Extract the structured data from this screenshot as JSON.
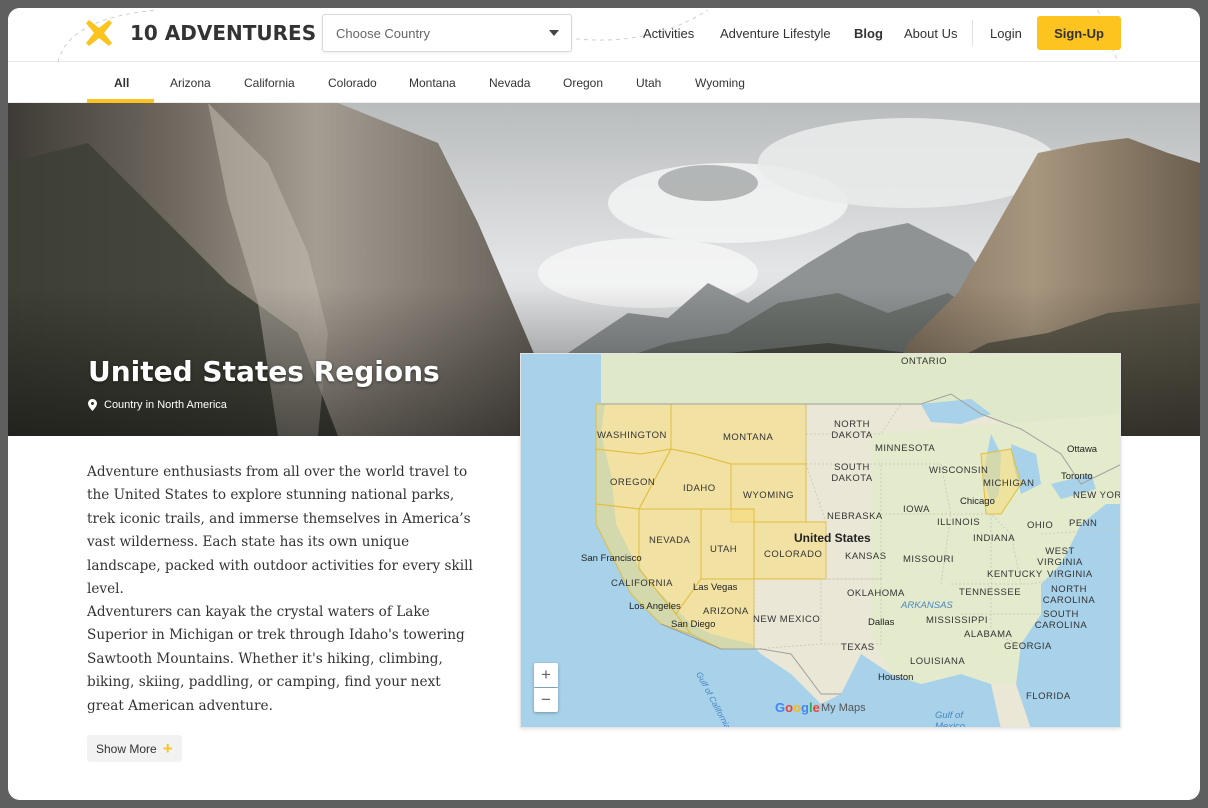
{
  "brand": {
    "name": "10 ADVENTURES",
    "logo_icon": "x-mark-icon",
    "accent": "#fdc31f"
  },
  "header": {
    "country_select": {
      "placeholder": "Choose Country"
    },
    "nav": [
      {
        "label": "Activities"
      },
      {
        "label": "Adventure Lifestyle"
      },
      {
        "label": "Blog"
      },
      {
        "label": "About Us"
      }
    ],
    "login": "Login",
    "signup": "Sign-Up"
  },
  "tabs": [
    "All",
    "Arizona",
    "California",
    "Colorado",
    "Montana",
    "Nevada",
    "Oregon",
    "Utah",
    "Wyoming"
  ],
  "active_tab": "All",
  "hero": {
    "title": "United States Regions",
    "subtitle": "Country in North America"
  },
  "description": {
    "paragraph1": "Adventure enthusiasts from all over the world travel to the United States to explore stunning national parks, trek iconic trails, and immerse themselves in America’s vast wilderness. Each state has its own unique landscape, packed with outdoor activities for every skill level.",
    "paragraph2": "Adventurers can kayak the crystal waters of Lake Superior in Michigan or trek through Idaho's towering Sawtooth Mountains. Whether it's hiking, climbing, biking, skiing, paddling, or camping, find your next great American adventure.",
    "show_more": "Show More"
  },
  "map": {
    "country_label": "United States",
    "states": [
      "WASHINGTON",
      "MONTANA",
      "NORTH DAKOTA",
      "MINNESOTA",
      "OREGON",
      "IDAHO",
      "WYOMING",
      "SOUTH DAKOTA",
      "WISCONSIN",
      "MICHIGAN",
      "NEBRASKA",
      "IOWA",
      "NEVADA",
      "UTAH",
      "COLORADO",
      "KANSAS",
      "MISSOURI",
      "ILLINOIS",
      "INDIANA",
      "OHIO",
      "PENN",
      "CALIFORNIA",
      "ARIZONA",
      "NEW MEXICO",
      "OKLAHOMA",
      "ARKANSAS",
      "TENNESSEE",
      "KENTUCKY",
      "WEST VIRGINIA",
      "VIRGINIA",
      "NORTH CAROLINA",
      "SOUTH CAROLINA",
      "MISSISSIPPI",
      "ALABAMA",
      "GEORGIA",
      "TEXAS",
      "LOUISIANA",
      "FLORIDA",
      "NEW YOR",
      "ONTARIO"
    ],
    "cities": [
      "Ottawa",
      "Toronto",
      "Chicago",
      "San Francisco",
      "Las Vegas",
      "Los Angeles",
      "San Diego",
      "Dallas",
      "Houston"
    ],
    "water": [
      "Gulf of Mexico",
      "Gulf of California"
    ],
    "zoom_in": "+",
    "zoom_out": "−",
    "attribution": "My Maps",
    "google": [
      "G",
      "o",
      "o",
      "g",
      "l",
      "e"
    ]
  }
}
